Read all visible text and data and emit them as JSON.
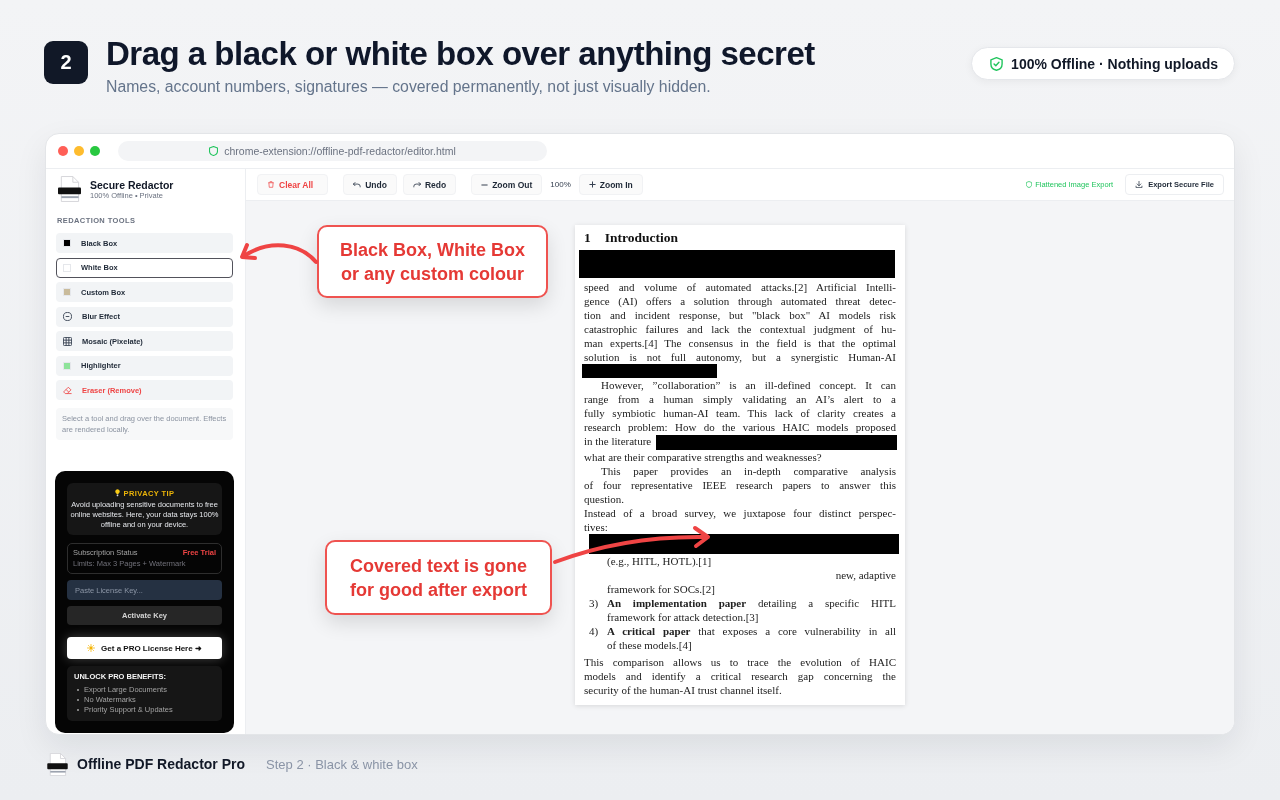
{
  "header": {
    "step": "2",
    "title": "Drag a black or white box over anything secret",
    "subtitle": "Names, account numbers, signatures — covered permanently, not just visually hidden.",
    "badge": "100% Offline · Nothing uploads"
  },
  "window": {
    "url": "chrome-extension://offline-pdf-redactor/editor.html"
  },
  "sidebar": {
    "app_name": "Secure Redactor",
    "app_tagline": "100% Offline • Private",
    "section_label": "REDACTION TOOLS",
    "tools": [
      {
        "label": "Black Box",
        "kind": "swatch",
        "color": "#000000",
        "selected": false
      },
      {
        "label": "White Box",
        "kind": "swatch",
        "color": "#ffffff",
        "selected": true
      },
      {
        "label": "Custom Box",
        "kind": "swatch",
        "color": "#c9bb9b",
        "selected": false
      },
      {
        "label": "Blur Effect",
        "kind": "blur",
        "selected": false
      },
      {
        "label": "Mosaic (Pixelate)",
        "kind": "mosaic",
        "selected": false
      },
      {
        "label": "Highlighter",
        "kind": "swatch",
        "color": "#8ee39a",
        "selected": false
      },
      {
        "label": "Eraser (Remove)",
        "kind": "eraser",
        "selected": false
      }
    ],
    "hint": "Select a tool and drag over the document. Effects are rendered locally."
  },
  "pro_panel": {
    "tip_title": "PRIVACY TIP",
    "tip_text": "Avoid uploading sensitive documents to free online websites. Here, your data stays 100% offline and on your device.",
    "status_label": "Subscription Status",
    "status_value": "Free Trial",
    "status_limits": "Limits: Max 3 Pages + Watermark",
    "license_placeholder": "Paste License Key...",
    "activate_button": "Activate Key",
    "pro_button": "Get a PRO License Here ➜",
    "benefits_title": "UNLOCK PRO BENEFITS:",
    "benefits": [
      "Export Large Documents",
      "No Watermarks",
      "Priority Support & Updates"
    ]
  },
  "toolbar": {
    "items": [
      {
        "kind": "clear",
        "label": "Clear All"
      },
      {
        "kind": "undo",
        "label": "Undo"
      },
      {
        "kind": "redo",
        "label": "Redo"
      },
      {
        "kind": "zoom-out",
        "label": "Zoom Out"
      },
      {
        "kind": "zoom-value",
        "label": "100%"
      },
      {
        "kind": "zoom-in",
        "label": "Zoom In"
      }
    ],
    "export_note": "Flattened Image Export",
    "export_button": "Export Secure File"
  },
  "document": {
    "section_number": "1",
    "section_title": "Introduction",
    "blocks": [
      {
        "kind": "redaction-block"
      },
      {
        "kind": "justified",
        "text": "speed and volume of automated attacks.[2] Artificial Intelli-"
      },
      {
        "kind": "justified",
        "text": "gence (AI) offers a solution through automated threat detec-"
      },
      {
        "kind": "justified",
        "text": "tion and incident response, but \"black box\" AI models risk"
      },
      {
        "kind": "justified",
        "text": "catastrophic failures and lack the contextual judgment of hu-"
      },
      {
        "kind": "justified",
        "text": "man experts.[4] The consensus in the field is that the optimal"
      },
      {
        "kind": "justified",
        "text": "solution is not full autonomy, but a synergistic Human-AI"
      },
      {
        "kind": "redaction-short"
      },
      {
        "kind": "indented",
        "text": "However, ”collaboration” is an ill-defined concept. It can"
      },
      {
        "kind": "justified",
        "text": "range from a human simply validating an AI’s alert to a"
      },
      {
        "kind": "justified",
        "text": "fully symbiotic human-AI team. This lack of clarity creates a"
      },
      {
        "kind": "justified",
        "text": "research problem: How do the various HAIC models proposed"
      },
      {
        "kind": "left",
        "text": "in the literature",
        "redacted_after": true
      },
      {
        "kind": "left",
        "text": "what are their comparative strengths and weaknesses?"
      },
      {
        "kind": "indented",
        "text": "This paper provides an in-depth comparative analysis"
      },
      {
        "kind": "justified",
        "text": "of four representative IEEE research papers to answer this"
      },
      {
        "kind": "left",
        "text": "question."
      },
      {
        "kind": "justified",
        "text": "Instead of a broad survey, we juxtapose four distinct perspec-"
      },
      {
        "kind": "left",
        "text": "tives:"
      },
      {
        "kind": "redaction-band"
      },
      {
        "kind": "list",
        "children": [
          {
            "lines": [
              {
                "kind": "left",
                "text": "(e.g., HITL, HOTL).[1]"
              }
            ]
          },
          {
            "lines": [
              {
                "kind": "right",
                "text": "new, adaptive"
              },
              {
                "kind": "left",
                "text": "framework for SOCs.[2]"
              }
            ]
          },
          {
            "marker": "3)",
            "lines": [
              {
                "kind": "justified",
                "text": "**An implementation paper** detailing a specific HITL"
              },
              {
                "kind": "left",
                "text": "framework for attack detection.[3]"
              }
            ]
          },
          {
            "marker": "4)",
            "lines": [
              {
                "kind": "justified",
                "text": "**A critical paper** that exposes a core vulnerability in all"
              },
              {
                "kind": "left",
                "text": "of these models.[4]"
              }
            ]
          }
        ]
      },
      {
        "kind": "justified",
        "text": "This comparison allows us to trace the evolution of HAIC"
      },
      {
        "kind": "justified",
        "text": "models and identify a critical research gap concerning the"
      },
      {
        "kind": "left",
        "text": "security of the human-AI trust channel itself."
      }
    ]
  },
  "callouts": [
    "Black Box, White Box\nor any custom colour",
    "Covered text is gone\nfor good after export"
  ],
  "footer": {
    "product": "Offline PDF Redactor Pro",
    "step": "Step 2 · Black & white box"
  }
}
